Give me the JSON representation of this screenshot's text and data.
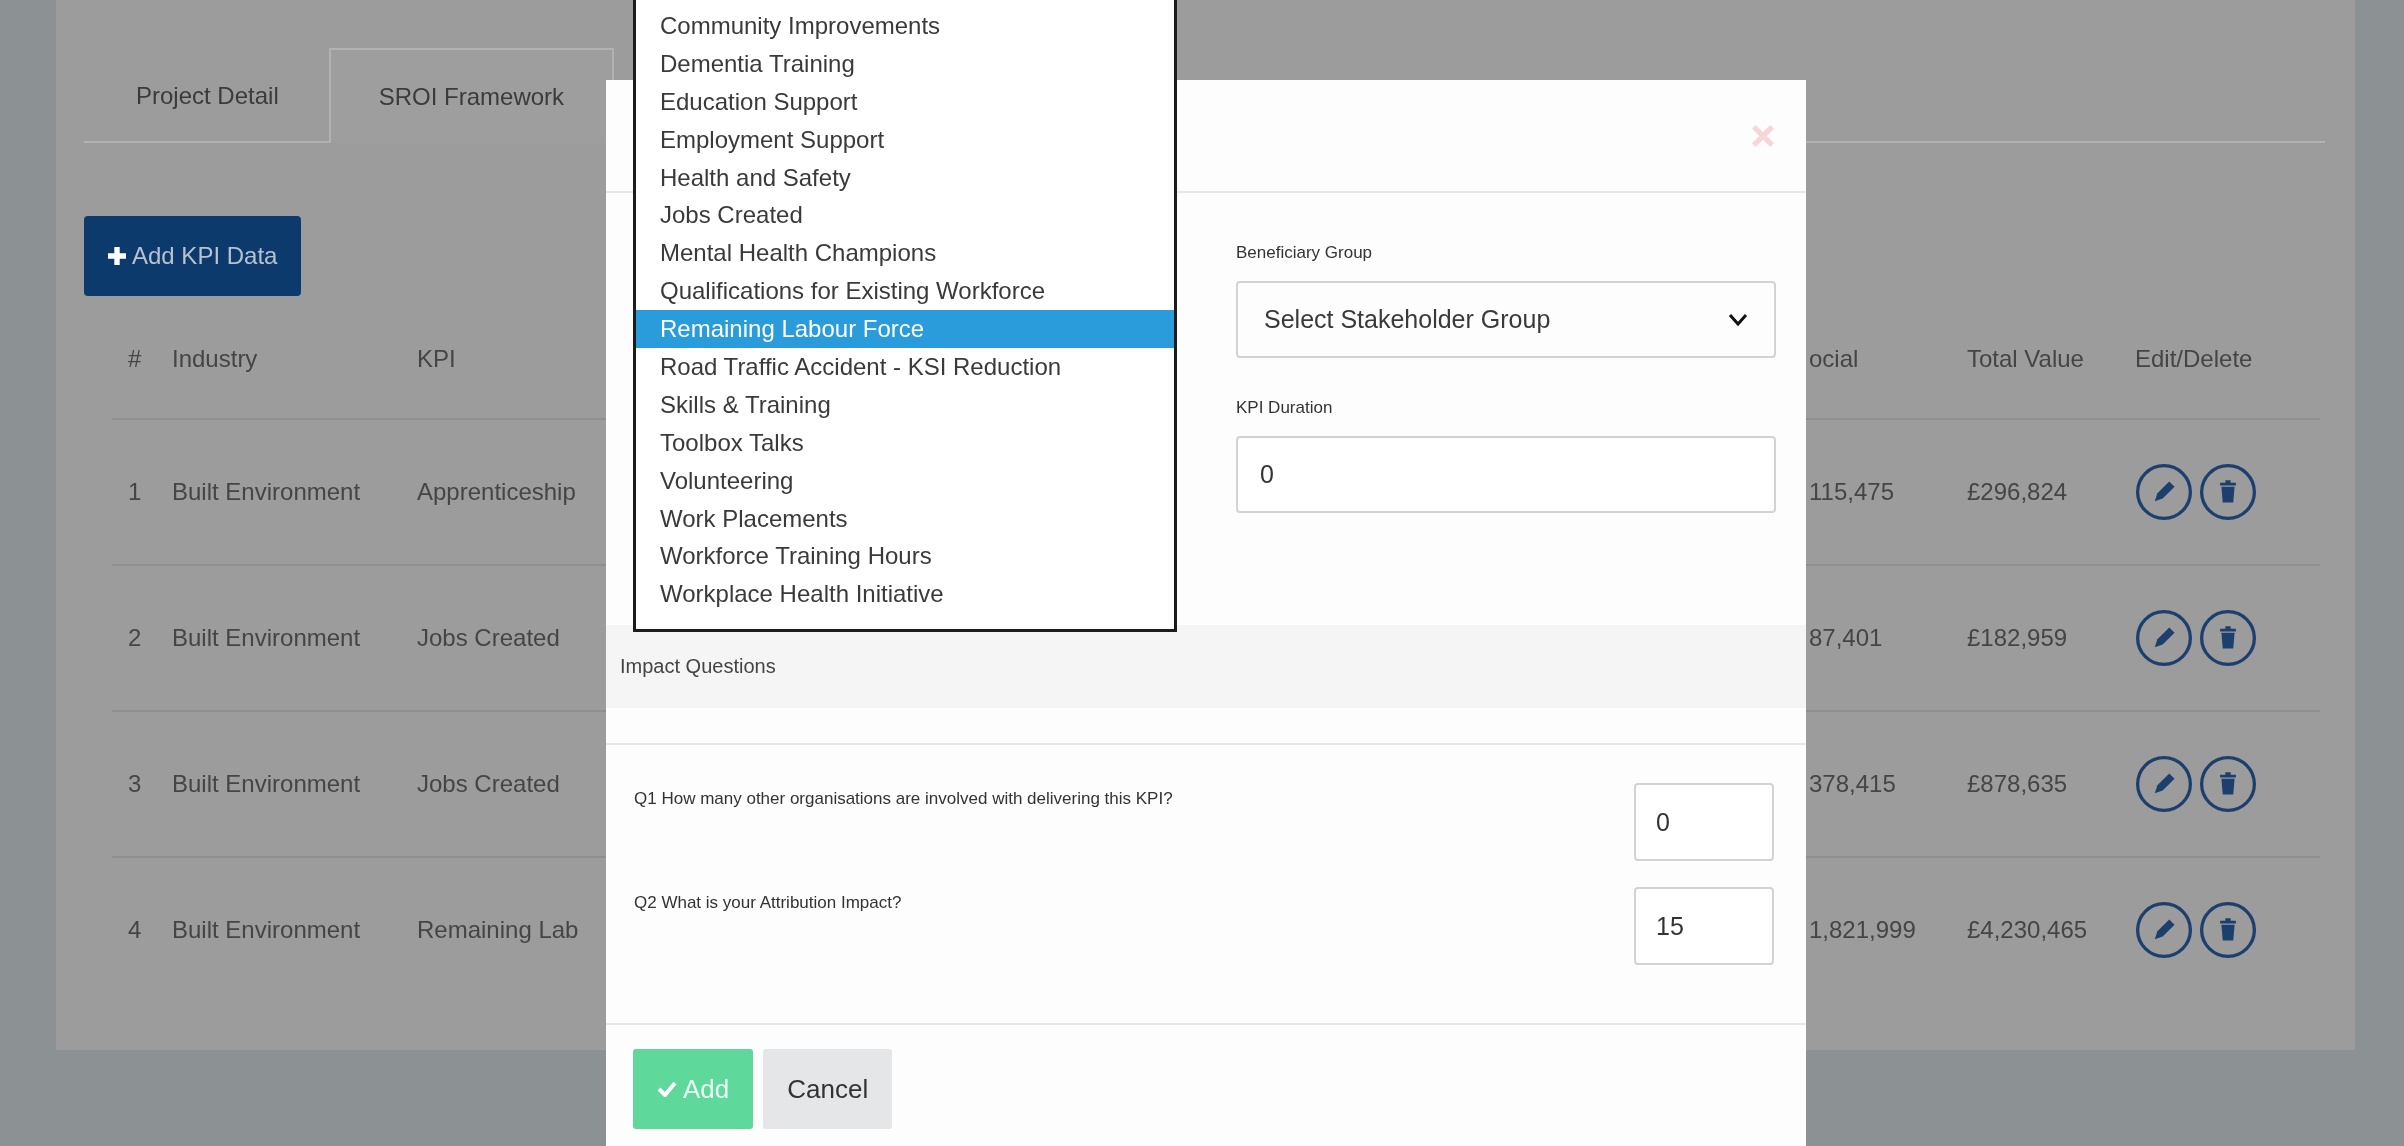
{
  "tabs": [
    {
      "label": "Project Detail",
      "selected": false
    },
    {
      "label": "SROI Framework",
      "selected": true
    }
  ],
  "add_button": {
    "label": "Add KPI Data"
  },
  "table": {
    "columns": [
      "#",
      "Industry",
      "KPI",
      "ocial",
      "Total Value",
      "Edit/Delete"
    ],
    "rows": [
      {
        "number": "1",
        "industry": "Built Environment",
        "kpi": "Apprenticeship",
        "social": "115,475",
        "total_value": "£296,824"
      },
      {
        "number": "2",
        "industry": "Built Environment",
        "kpi": "Jobs Created",
        "social": "87,401",
        "total_value": "£182,959"
      },
      {
        "number": "3",
        "industry": "Built Environment",
        "kpi": "Jobs Created",
        "social": "378,415",
        "total_value": "£878,635"
      },
      {
        "number": "4",
        "industry": "Built Environment",
        "kpi": "Remaining Lab",
        "social": "1,821,999",
        "total_value": "£4,230,465"
      }
    ]
  },
  "modal": {
    "beneficiary_group": {
      "label": "Beneficiary Group",
      "value": "Select Stakeholder Group"
    },
    "kpi_duration": {
      "label": "KPI Duration",
      "value": "0"
    },
    "section_title": "Impact Questions",
    "questions": [
      {
        "text": "Q1 How many other organisations are involved with delivering this KPI?",
        "value": "0"
      },
      {
        "text": "Q2 What is your Attribution Impact?",
        "value": "15"
      }
    ],
    "buttons": [
      {
        "label": "Add",
        "kind": "primary"
      },
      {
        "label": "Cancel",
        "kind": "secondary"
      }
    ]
  },
  "dropdown": {
    "options": [
      {
        "label": "Community Improvements",
        "selected": false
      },
      {
        "label": "Dementia Training",
        "selected": false
      },
      {
        "label": "Education Support",
        "selected": false
      },
      {
        "label": "Employment Support",
        "selected": false
      },
      {
        "label": "Health and Safety",
        "selected": false
      },
      {
        "label": "Jobs Created",
        "selected": false
      },
      {
        "label": "Mental Health Champions",
        "selected": false
      },
      {
        "label": "Qualifications for Existing Workforce",
        "selected": false
      },
      {
        "label": "Remaining Labour Force",
        "selected": true
      },
      {
        "label": "Road Traffic Accident - KSI Reduction",
        "selected": false
      },
      {
        "label": "Skills & Training",
        "selected": false
      },
      {
        "label": "Toolbox Talks",
        "selected": false
      },
      {
        "label": "Volunteering",
        "selected": false
      },
      {
        "label": "Work Placements",
        "selected": false
      },
      {
        "label": "Workforce Training Hours",
        "selected": false
      },
      {
        "label": "Workplace Health Initiative",
        "selected": false
      }
    ]
  }
}
